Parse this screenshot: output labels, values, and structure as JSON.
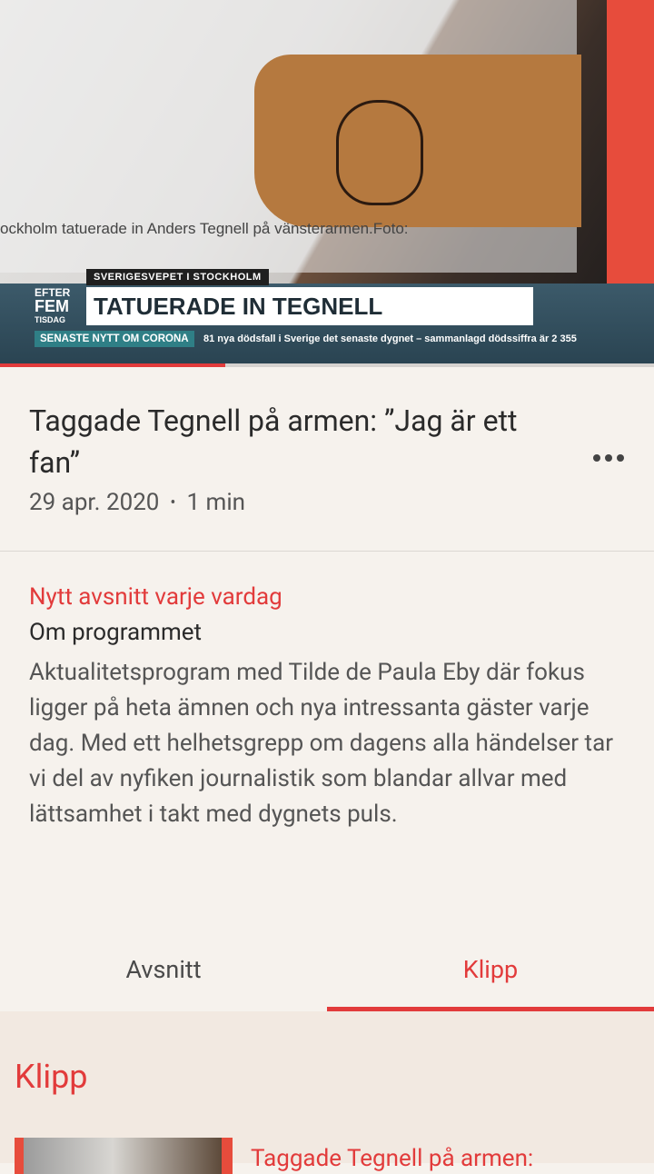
{
  "video": {
    "caption": "ockholm tatuerade in Anders Tegnell på vänsterarmen.Foto:",
    "lower_third": {
      "logo_line1": "EFTER",
      "logo_line2": "FEM",
      "logo_line3": "TISDAG",
      "kicker": "SVERIGESVEPET I STOCKHOLM",
      "headline": "TATUERADE IN TEGNELL",
      "ticker_tag": "SENASTE NYTT OM CORONA",
      "ticker_text": "81 nya dödsfall i Sverige det senaste dygnet – sammanlagd dödssiffra är 2 355"
    },
    "progress_fraction": 0.345,
    "colors": {
      "progress": "#e23b3b",
      "track": "#d5d2cf"
    }
  },
  "episode": {
    "title": "Taggade Tegnell på armen: ”Jag är ett fan”",
    "date": "29 apr. 2020",
    "separator": "•",
    "duration": "1 min",
    "more_icon": "more-horizontal-icon"
  },
  "program": {
    "schedule": "Nytt avsnitt varje vardag",
    "about_heading": "Om programmet",
    "about_text": "Aktualitetsprogram med Tilde de Paula Eby där fokus ligger på heta ämnen och nya intressanta gäster varje dag. Med ett helhetsgrepp om dagens alla händelser tar vi del av nyfiken journalistik som blandar allvar med lättsamhet i takt med dygnets puls."
  },
  "tabs": {
    "episodes": "Avsnitt",
    "clips": "Klipp",
    "active": "clips"
  },
  "clips": {
    "heading": "Klipp",
    "items": [
      {
        "title": "Taggade Tegnell på armen:"
      }
    ]
  },
  "accent_color": "#e23b3b"
}
